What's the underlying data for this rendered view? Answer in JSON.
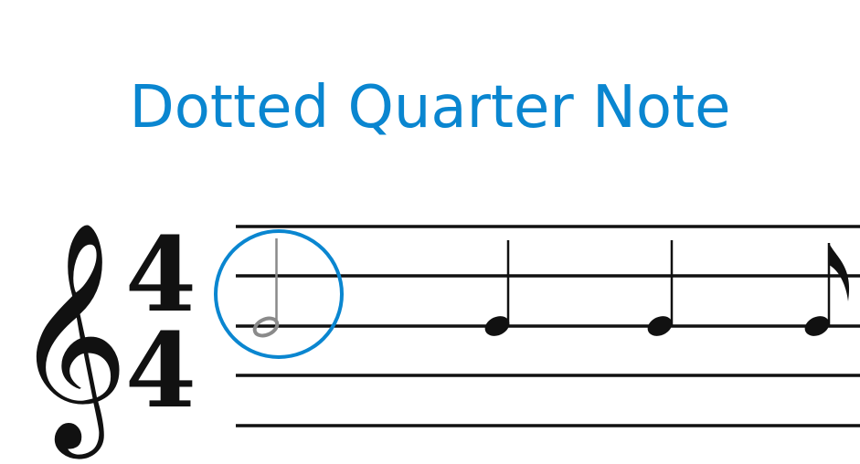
{
  "title": "Dotted Quarter Note",
  "time_signature": {
    "numerator": "4",
    "denominator": "4"
  },
  "colors": {
    "title": "#0a86d0",
    "highlight_circle": "#0a86d0",
    "staff": "#111111"
  },
  "clef": "treble-clef",
  "notes": [
    {
      "type": "half",
      "highlighted": true
    },
    {
      "type": "quarter",
      "highlighted": false
    },
    {
      "type": "quarter",
      "highlighted": false
    },
    {
      "type": "eighth",
      "highlighted": false
    }
  ]
}
